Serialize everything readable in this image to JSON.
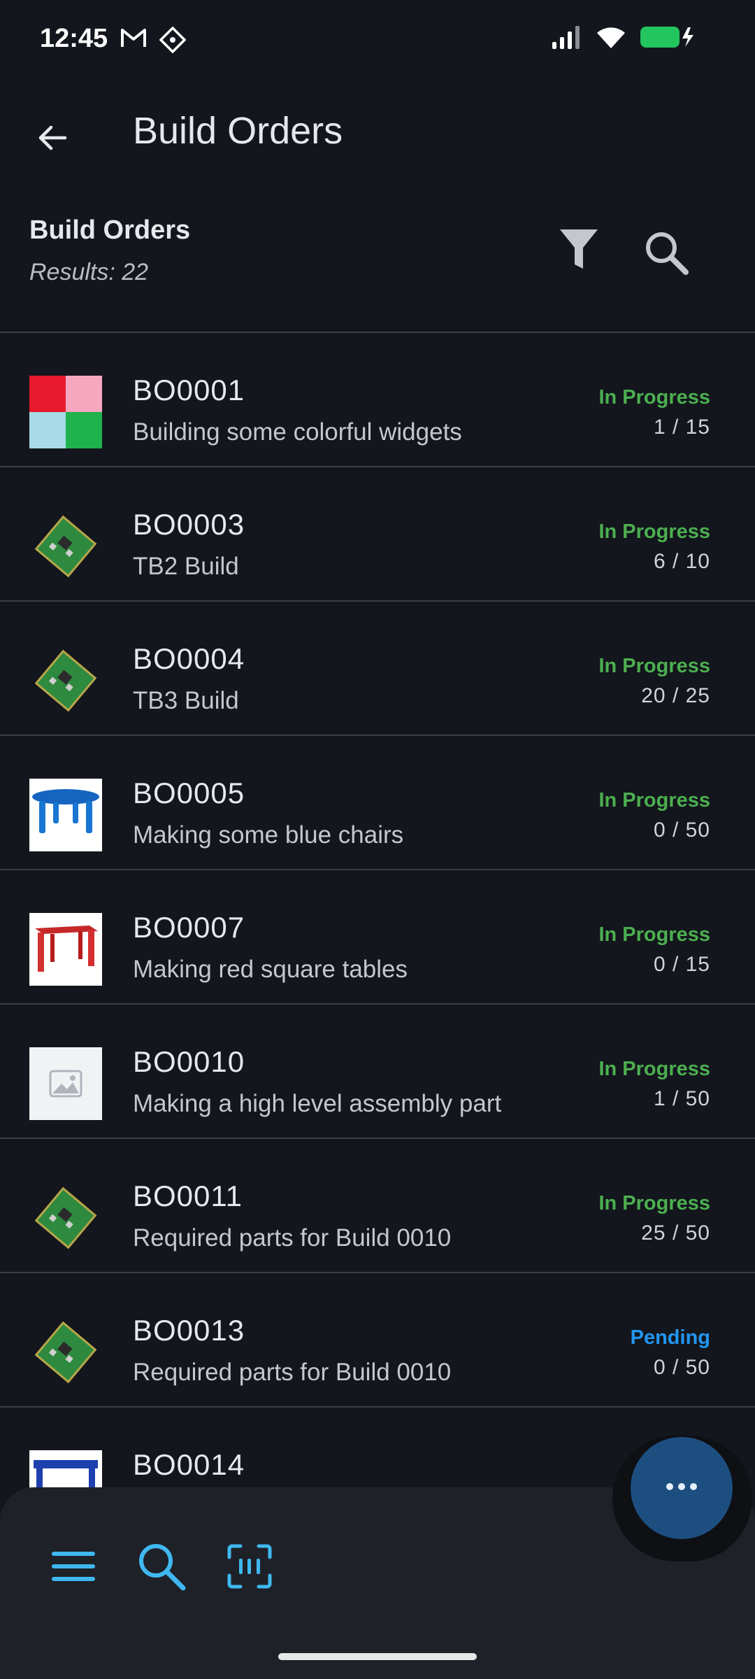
{
  "status_bar": {
    "time": "12:45",
    "left_icons": [
      "gmail-icon",
      "app-notification-icon"
    ],
    "right_icons": [
      "signal-icon",
      "wifi-icon",
      "battery-charging-icon"
    ],
    "battery_color": "#22c55e"
  },
  "app_bar": {
    "title": "Build Orders"
  },
  "header": {
    "title": "Build Orders",
    "results": "Results: 22"
  },
  "colors": {
    "in_progress": "#4caf50",
    "pending": "#2196f3",
    "accent": "#3fb8f0"
  },
  "orders": [
    {
      "reference": "BO0001",
      "description": "Building some colorful widgets",
      "status": "In Progress",
      "progress": "1 / 15",
      "thumbnail": "color-squares"
    },
    {
      "reference": "BO0003",
      "description": "TB2 Build",
      "status": "In Progress",
      "progress": "6 / 10",
      "thumbnail": "circuit-board"
    },
    {
      "reference": "BO0004",
      "description": "TB3 Build",
      "status": "In Progress",
      "progress": "20 / 25",
      "thumbnail": "circuit-board"
    },
    {
      "reference": "BO0005",
      "description": "Making some blue chairs",
      "status": "In Progress",
      "progress": "0 / 50",
      "thumbnail": "blue-round-table"
    },
    {
      "reference": "BO0007",
      "description": "Making red square tables",
      "status": "In Progress",
      "progress": "0 / 15",
      "thumbnail": "red-table"
    },
    {
      "reference": "BO0010",
      "description": "Making a high level assembly part",
      "status": "In Progress",
      "progress": "1 / 50",
      "thumbnail": "image-placeholder"
    },
    {
      "reference": "BO0011",
      "description": "Required parts for Build 0010",
      "status": "In Progress",
      "progress": "25 / 50",
      "thumbnail": "circuit-board"
    },
    {
      "reference": "BO0013",
      "description": "Required parts for Build 0010",
      "status": "Pending",
      "progress": "0 / 50",
      "thumbnail": "circuit-board"
    },
    {
      "reference": "BO0014",
      "description": "",
      "status": "",
      "progress": "",
      "thumbnail": "blue-table"
    }
  ],
  "bottom_nav": {
    "items": [
      "menu-icon",
      "search-icon",
      "scan-icon"
    ]
  },
  "fab": {
    "icon": "more-horizontal-icon"
  }
}
